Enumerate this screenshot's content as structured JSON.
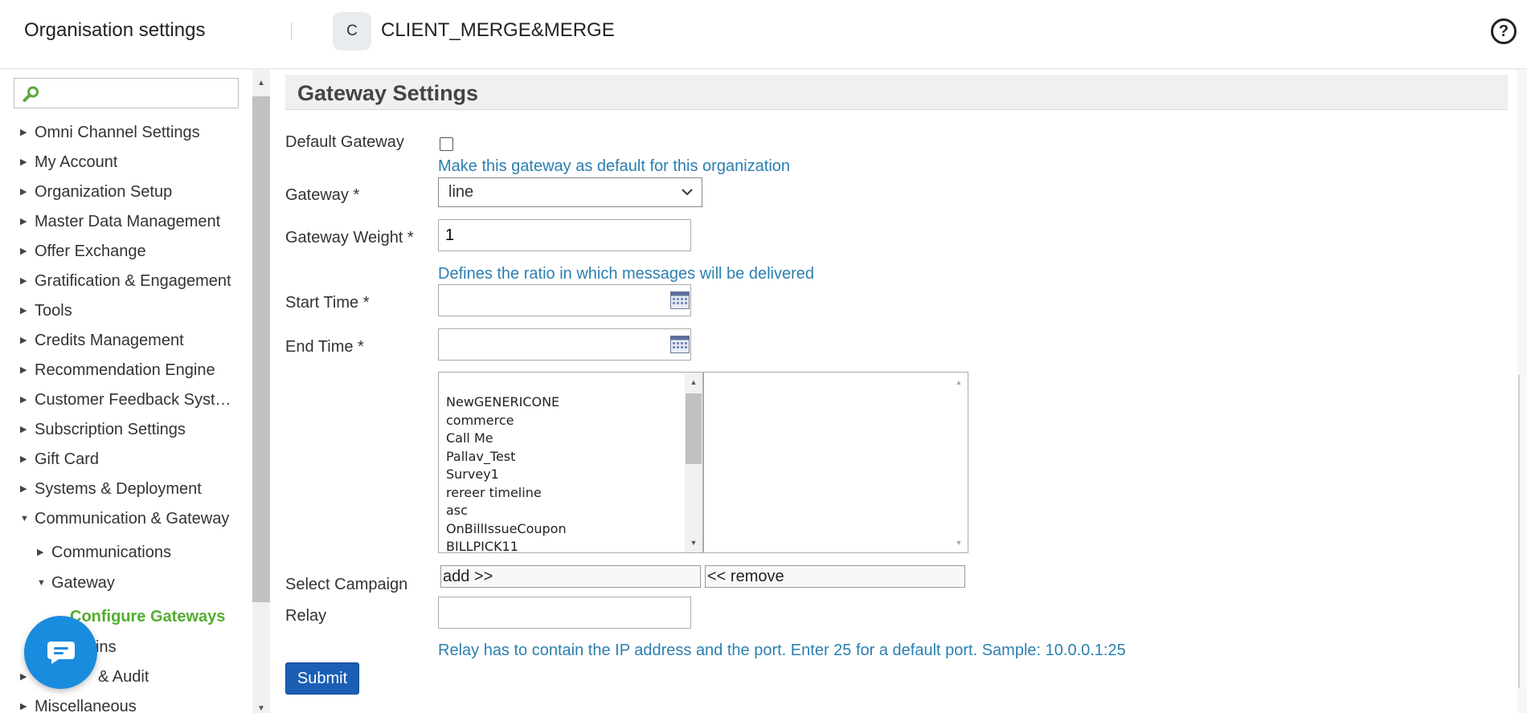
{
  "header": {
    "title": "Organisation settings",
    "org_initial": "C",
    "org_name": "CLIENT_MERGE&MERGE",
    "help_glyph": "?"
  },
  "sidebar": {
    "search_placeholder": "",
    "items": [
      {
        "label": "Omni Channel Settings",
        "arrow": "▶"
      },
      {
        "label": "My Account",
        "arrow": "▶"
      },
      {
        "label": "Organization Setup",
        "arrow": "▶"
      },
      {
        "label": "Master Data Management",
        "arrow": "▶"
      },
      {
        "label": "Offer Exchange",
        "arrow": "▶"
      },
      {
        "label": "Gratification & Engagement",
        "arrow": "▶"
      },
      {
        "label": "Tools",
        "arrow": "▶"
      },
      {
        "label": "Credits Management",
        "arrow": "▶"
      },
      {
        "label": "Recommendation Engine",
        "arrow": "▶"
      },
      {
        "label": "Customer Feedback System",
        "arrow": "▶"
      },
      {
        "label": "Subscription Settings",
        "arrow": "▶"
      },
      {
        "label": "Gift Card",
        "arrow": "▶"
      },
      {
        "label": "Systems & Deployment",
        "arrow": "▶"
      },
      {
        "label": "Communication & Gateway",
        "arrow": "▼"
      },
      {
        "label": "Communications",
        "arrow": "▶"
      },
      {
        "label": "Gateway",
        "arrow": "▼"
      },
      {
        "label": "Configure Gateways"
      },
      {
        "label": "ins"
      },
      {
        "label": "& Audit",
        "arrow": "▶"
      },
      {
        "label": "Miscellaneous",
        "arrow": "▶"
      }
    ]
  },
  "main": {
    "section_title": "Gateway Settings",
    "default_gateway": {
      "label": "Default Gateway",
      "hint": "Make this gateway as default for this organization",
      "checked": false
    },
    "gateway": {
      "label": "Gateway *",
      "value": "line"
    },
    "gateway_weight": {
      "label": "Gateway Weight *",
      "value": "1",
      "hint": "Defines the ratio in which messages will be delivered"
    },
    "start_time": {
      "label": "Start Time *",
      "value": ""
    },
    "end_time": {
      "label": "End Time *",
      "value": ""
    },
    "campaign": {
      "label": "Select Campaign",
      "available": [
        "NewGENERICONE",
        "commerce",
        "Call Me",
        "Pallav_Test",
        "Survey1",
        "rereer timeline",
        "asc",
        "OnBillIssueCoupon",
        "BILLPICK11"
      ],
      "selected": [],
      "add_label": "add >>",
      "remove_label": "<< remove"
    },
    "relay": {
      "label": "Relay",
      "value": "",
      "hint": "Relay has to contain the IP address and the port. Enter 25 for a default port. Sample: 10.0.0.1:25"
    },
    "submit_label": "Submit"
  },
  "colors": {
    "accent_blue": "#1a5fb4",
    "hint_blue": "#2b7fb0",
    "active_green": "#4aa832",
    "chat_blue": "#1a8cde"
  }
}
